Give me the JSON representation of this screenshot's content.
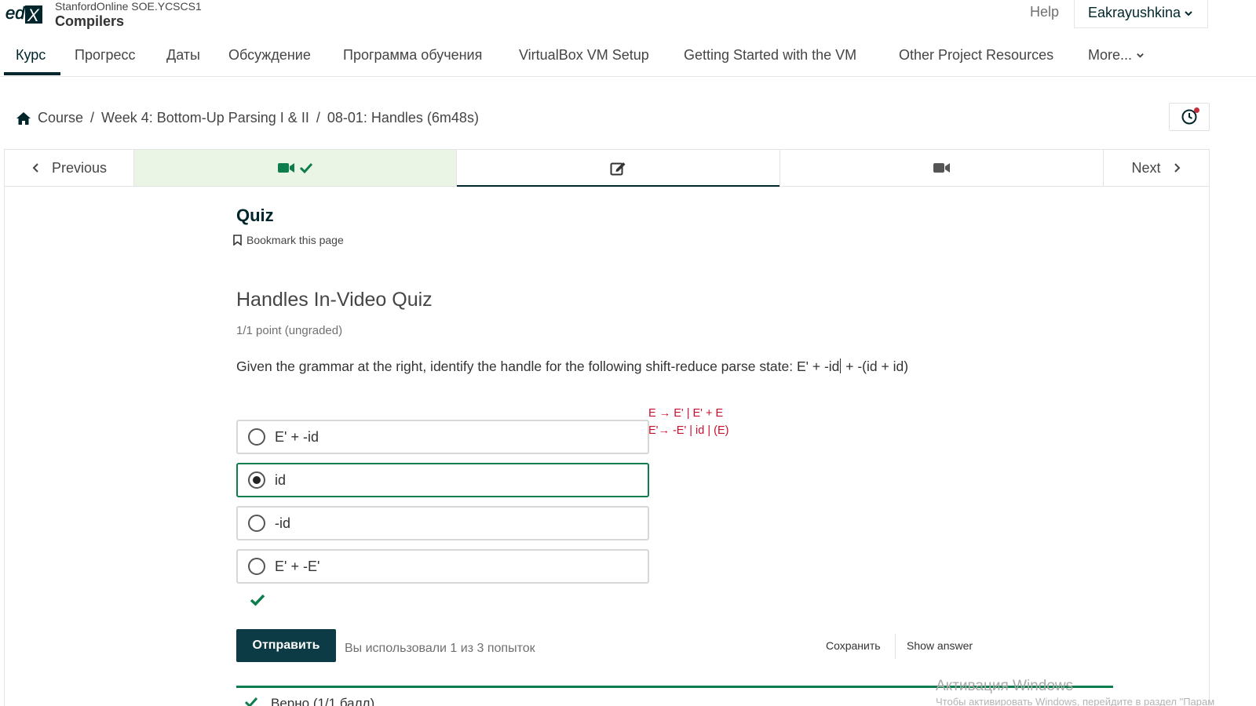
{
  "header": {
    "logo_text": "edX",
    "org": "StanfordOnline SOE.YCSCS1",
    "course_title": "Compilers",
    "help_label": "Help",
    "username": "Eakrayushkina"
  },
  "course_nav": {
    "tabs": [
      {
        "label": "Курс",
        "active": true
      },
      {
        "label": "Прогресс"
      },
      {
        "label": "Даты"
      },
      {
        "label": "Обсуждение"
      },
      {
        "label": "Программа обучения"
      },
      {
        "label": "VirtualBox VM Setup"
      },
      {
        "label": "Getting Started with the VM"
      },
      {
        "label": "Other Project Resources"
      },
      {
        "label": "More..."
      }
    ]
  },
  "breadcrumb": {
    "items": [
      "Course",
      "Week 4: Bottom-Up Parsing I & II",
      "08-01: Handles (6m48s)"
    ],
    "separator": "/"
  },
  "unit_nav": {
    "previous_label": "Previous",
    "next_label": "Next",
    "sequence": [
      {
        "icon": "video-camera-icon",
        "completed": true
      },
      {
        "icon": "edit-icon",
        "active": true
      },
      {
        "icon": "video-camera-icon"
      }
    ]
  },
  "unit": {
    "title": "Quiz",
    "bookmark_label": "Bookmark this page"
  },
  "problem": {
    "title": "Handles In-Video Quiz",
    "progress": "1/1 point (ungraded)",
    "question_text": "Given the grammar at the right, identify the handle for the following shift-reduce parse state: E' + -id",
    "question_text_after_cursor": " + -(id + id)",
    "grammar_lines": [
      "E → E' | E' + E",
      "E'→ -E' | id | (E)"
    ],
    "choices": [
      {
        "label": "E' + -id",
        "selected": false
      },
      {
        "label": "id",
        "selected": true
      },
      {
        "label": "-id",
        "selected": false
      },
      {
        "label": "E' + -E'",
        "selected": false
      }
    ],
    "submit_label": "Отправить",
    "attempts_text": "Вы использовали 1 из 3 попыток",
    "save_label": "Сохранить",
    "show_answer_label": "Show answer",
    "result_text": "Верно (1/1 балл)"
  },
  "os_overlay": {
    "title": "Активация Windows",
    "subtitle": "Чтобы активировать Windows, перейдите в раздел \"Парам"
  },
  "colors": {
    "brand_dark": "#00262b",
    "submit_bg": "#0d3b45",
    "success_green": "#0d7d4d",
    "grammar_red": "#c8102e",
    "completed_bg": "#eaf5e6"
  }
}
